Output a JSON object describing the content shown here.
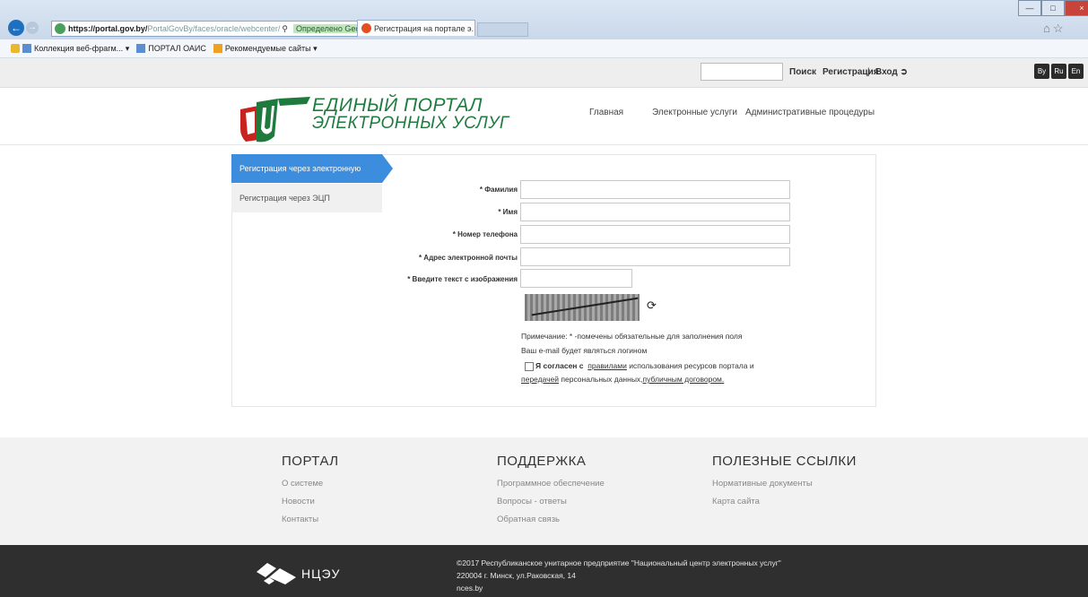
{
  "browser": {
    "url_host": "https://portal.gov.by/",
    "url_path": "PortalGovBy/faces/oracle/webcenter/",
    "cert_label": "Определено GeoTrust",
    "tab_title": "Регистрация на портале э...",
    "favorites": [
      "Коллекция веб-фрагм...",
      "ПОРТАЛ ОАИС",
      "Рекомендуемые сайты"
    ]
  },
  "topbar": {
    "search_button": "Поиск",
    "register": "Регистрация",
    "separator": "|",
    "login": "Вход",
    "languages": [
      "By",
      "Ru",
      "En"
    ]
  },
  "header": {
    "logo_line1": "ЕДИНЫЙ ПОРТАЛ",
    "logo_line2": "ЭЛЕКТРОННЫХ УСЛУГ",
    "nav": [
      "Главная",
      "Электронные услуги",
      "Административные процедуры"
    ]
  },
  "registration": {
    "tabs": [
      "Регистрация через электронную почту",
      "Регистрация через ЭЦП"
    ],
    "fields": [
      {
        "label": "* Фамилия",
        "value": ""
      },
      {
        "label": "* Имя",
        "value": ""
      },
      {
        "label": "* Номер телефона",
        "value": ""
      },
      {
        "label": "* Адрес электронной почты",
        "value": ""
      },
      {
        "label": "* Введите текст с изображения",
        "value": ""
      }
    ],
    "note": "Примечание: * -помечены обязательные для заполнения поля",
    "login_note": "Ваш e-mail будет являться логином",
    "agree_bold": "Я согласен с",
    "agree_link1": "правилами",
    "agree_text1": "использования ресурсов портала и",
    "agree_link2": "передачей",
    "agree_text2": "персональных данных,",
    "agree_link3": "публичным договором."
  },
  "footer": {
    "columns": [
      {
        "title": "ПОРТАЛ",
        "links": [
          "О системе",
          "Новости",
          "Контакты"
        ]
      },
      {
        "title": "ПОДДЕРЖКА",
        "links": [
          "Программное обеспечение",
          "Вопросы - ответы",
          "Обратная связь"
        ]
      },
      {
        "title": "ПОЛЕЗНЫЕ ССЫЛКИ",
        "links": [
          "Нормативные документы",
          "Карта сайта"
        ]
      }
    ],
    "org_short": "НЦЭУ",
    "copyright": "©2017 Республиканское унитарное предприятие \"Национальный центр электронных услуг\"",
    "address": "220004 г. Минск, ул.Раковская, 14",
    "site": "nces.by"
  },
  "colors": {
    "accent_blue": "#3c8dde",
    "logo_green": "#1f7a3e",
    "footer_dark": "#2f2f2f"
  }
}
